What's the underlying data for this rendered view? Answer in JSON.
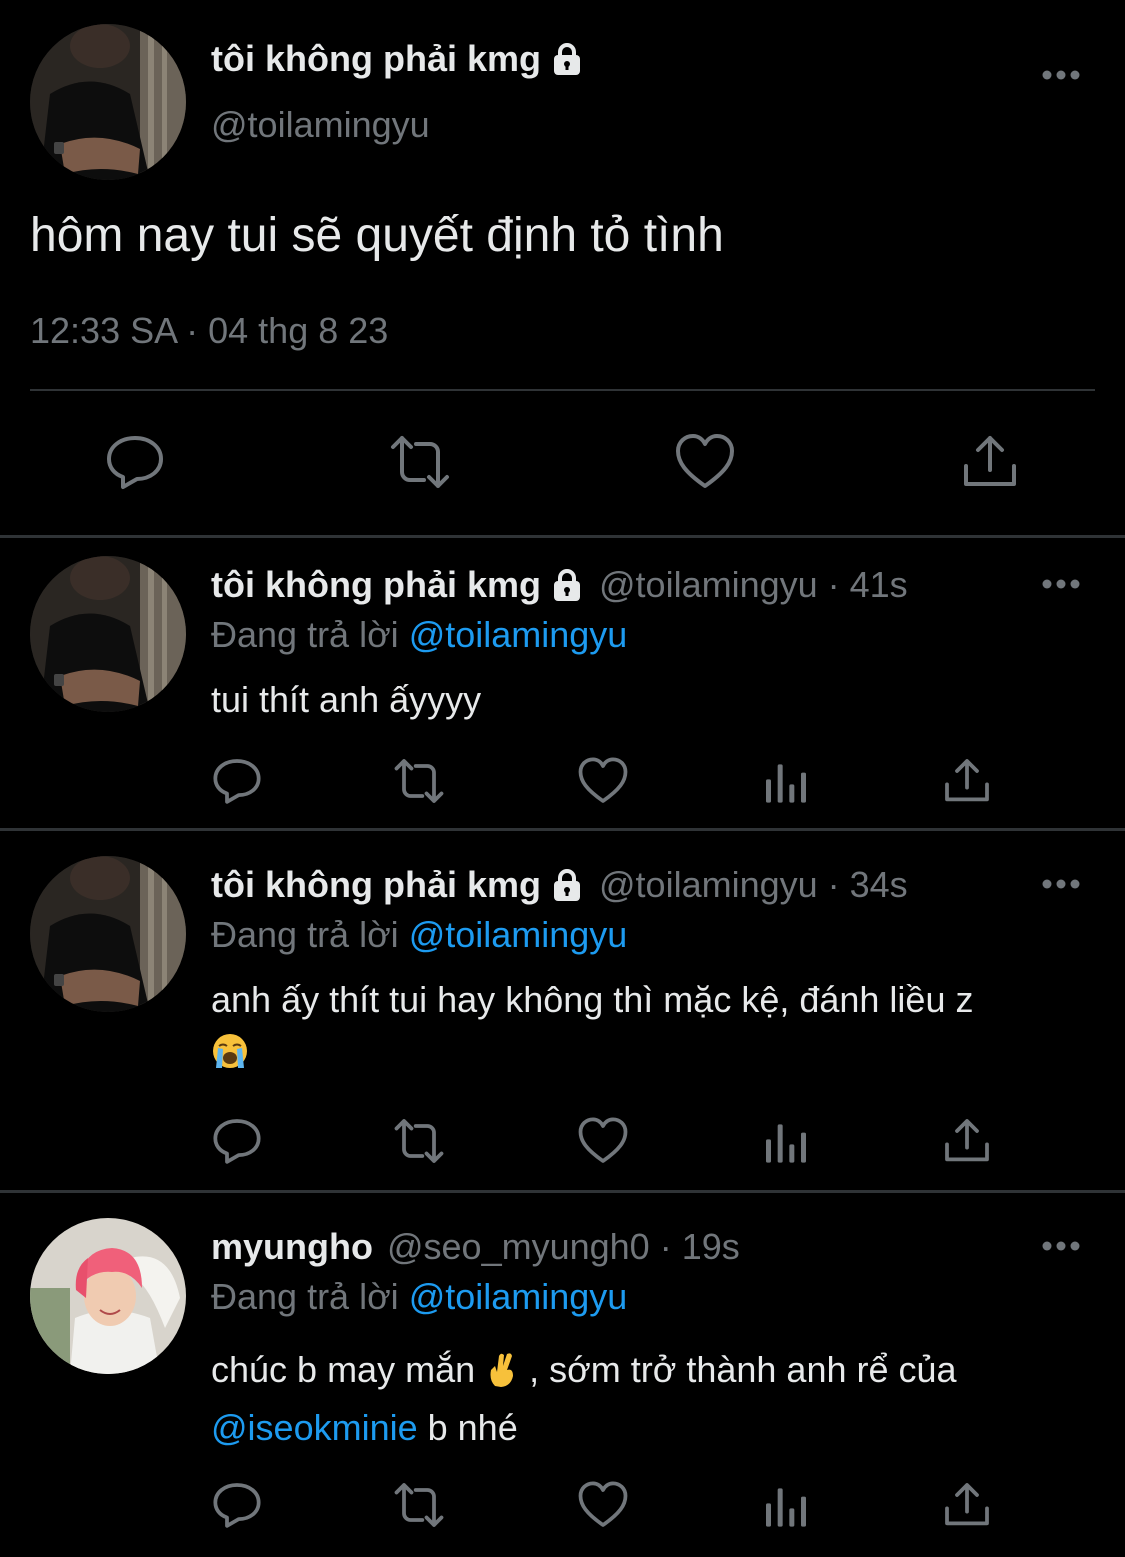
{
  "main_tweet": {
    "author": {
      "display_name": "tôi không phải kmg",
      "handle": "@toilamingyu",
      "protected": true
    },
    "text": "hôm nay tui sẽ quyết định tỏ tình",
    "timestamp": "12:33 SA · 04 thg 8 23",
    "actions": [
      "reply-icon",
      "retweet-icon",
      "like-icon",
      "share-icon"
    ]
  },
  "replies": [
    {
      "display_name": "tôi không phải kmg",
      "handle": "@toilamingyu",
      "dot": "·",
      "time": "41s",
      "replying_prefix": "Đang trả lời ",
      "replying_to": "@toilamingyu",
      "text": "tui thít anh ấyyyy",
      "avatar": "avatar-dark"
    },
    {
      "display_name": "tôi không phải kmg",
      "handle": "@toilamingyu",
      "dot": "·",
      "time": "34s",
      "replying_prefix": "Đang trả lời ",
      "replying_to": "@toilamingyu",
      "text": "anh ấy thít tui hay không thì mặc kệ, đánh liều z",
      "emoji": "loudly-crying-face-emoji",
      "avatar": "avatar-dark"
    },
    {
      "display_name": "myungho",
      "handle": "@seo_myungh0",
      "dot": "·",
      "time": "19s",
      "replying_prefix": "Đang trả lời ",
      "replying_to": "@toilamingyu",
      "text_part1": "chúc b may mắn ",
      "emoji": "crossed-fingers-emoji",
      "text_part2": " , sớm trở thành anh rể của ",
      "mention": "@iseokminie",
      "text_part3": " b nhé",
      "avatar": "avatar-pink-hair"
    }
  ],
  "colors": {
    "background": "#000000",
    "text": "#e7e9ea",
    "secondary": "#71767b",
    "link": "#1d9bf0",
    "divider": "#2f3336"
  }
}
